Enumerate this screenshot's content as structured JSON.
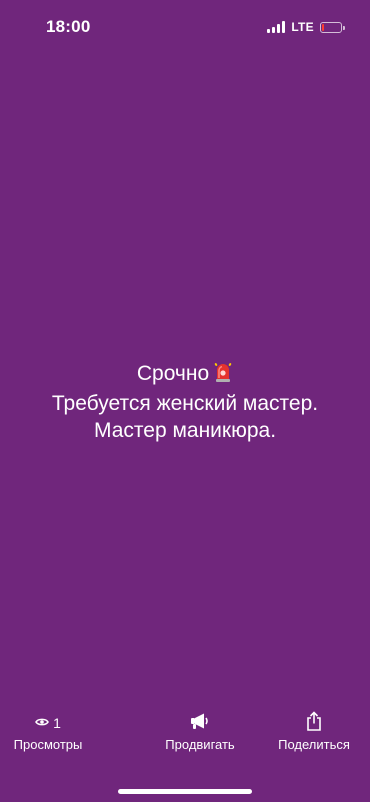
{
  "status_bar": {
    "time": "18:00",
    "network": "LTE",
    "battery_level": 0.1,
    "battery_color": "#ff3b30"
  },
  "story": {
    "line1_text": "Срочно",
    "line1_icon": "siren-emoji",
    "line2_text": "Требуется женский мастер.",
    "line3_text": "Мастер маникюра."
  },
  "bottom_bar": {
    "views": {
      "icon": "eye-icon",
      "count": "1",
      "label": "Просмотры"
    },
    "promote": {
      "icon": "megaphone-icon",
      "label": "Продвигать"
    },
    "share": {
      "icon": "share-icon",
      "label": "Поделиться"
    }
  },
  "colors": {
    "background": "#70267c",
    "text": "#ffffff"
  }
}
